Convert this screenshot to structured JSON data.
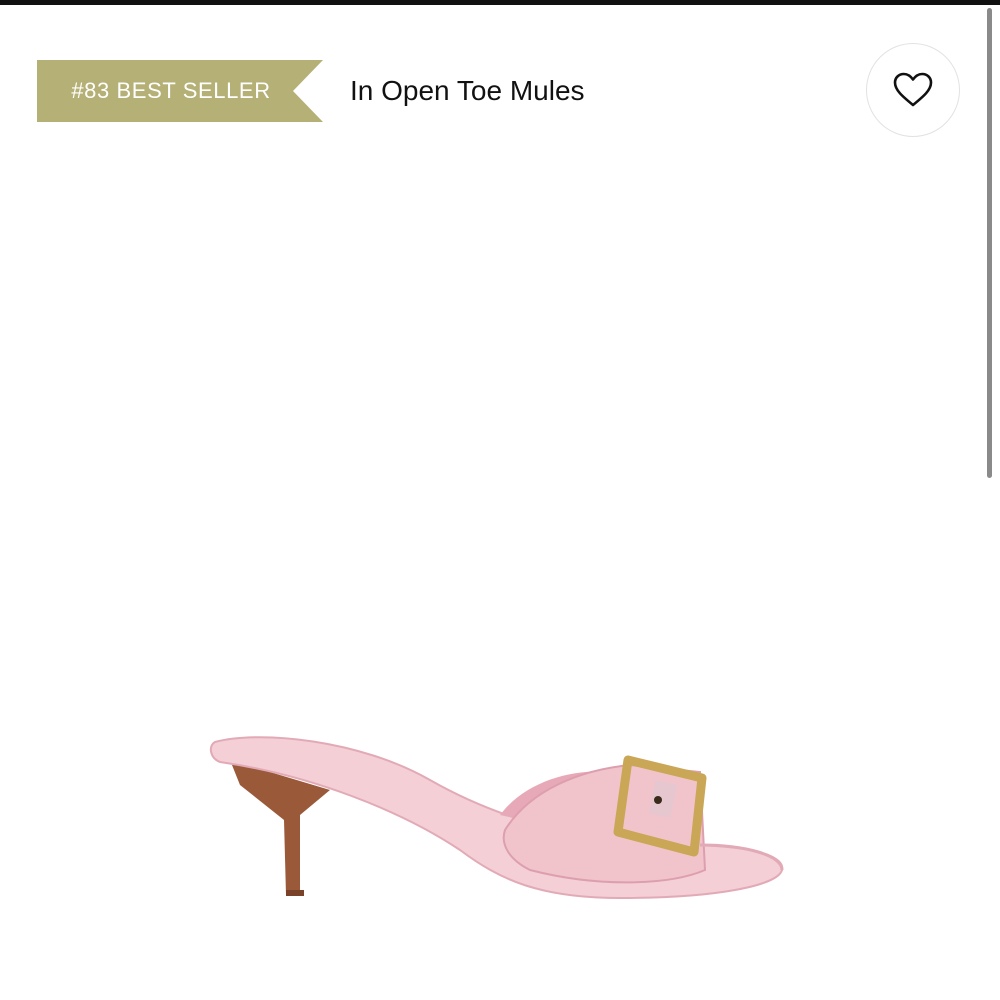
{
  "badge": {
    "text": "#83 BEST SELLER",
    "color": "#b5b075"
  },
  "category": {
    "text": "In Open Toe Mules"
  },
  "wishlist": {
    "icon": "heart-outline-icon"
  },
  "product": {
    "image": "pink-buckle-kitten-heel-mule",
    "colors": {
      "upper": "#f1c4cc",
      "buckle": "#c9a756",
      "heel": "#9a5a3a"
    }
  }
}
